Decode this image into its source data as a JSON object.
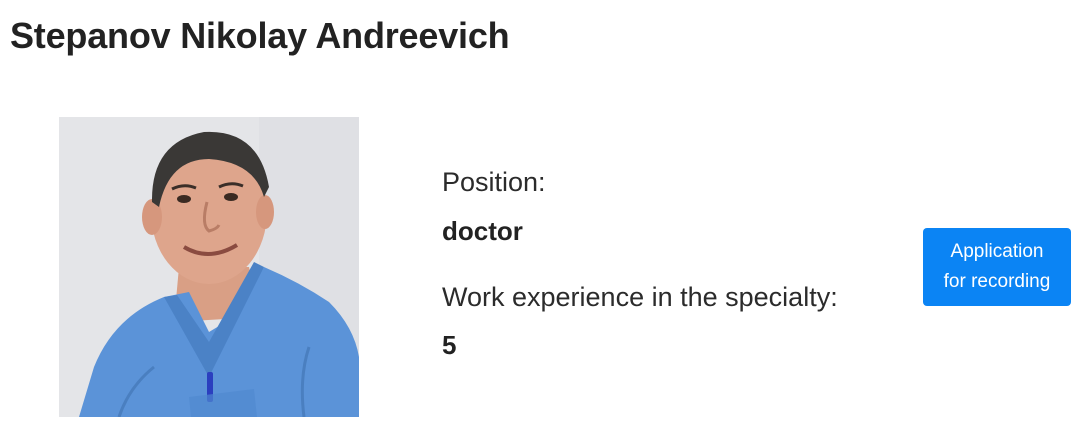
{
  "doctor": {
    "name": "Stepanov Nikolay Andreevich",
    "photo_alt": "Stepanov Nikolay Andreevich"
  },
  "details": {
    "position_label": "Position:",
    "position_value": "doctor",
    "experience_label": "Work experience in the specialty:",
    "experience_value": "5"
  },
  "actions": {
    "apply_line1": "Application",
    "apply_line2": "for recording"
  },
  "colors": {
    "accent": "#0b84f4",
    "text": "#222222",
    "scrubs": "#5b93d8"
  }
}
